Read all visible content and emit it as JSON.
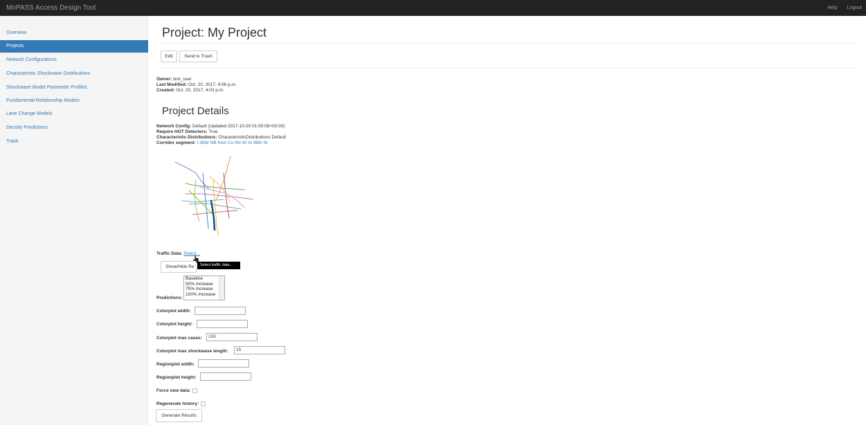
{
  "app": {
    "title": "MnPASS Access Design Tool"
  },
  "nav": {
    "help": "Help",
    "logout": "Logout"
  },
  "sidebar": {
    "items": [
      {
        "label": "Overview"
      },
      {
        "label": "Projects"
      },
      {
        "label": "Network Configurations"
      },
      {
        "label": "Characteristic Shockwave Distributions"
      },
      {
        "label": "Shockwave Model Parameter Profiles"
      },
      {
        "label": "Fundamental Relationship Models"
      },
      {
        "label": "Lane Change Models"
      },
      {
        "label": "Density Predictions"
      },
      {
        "label": "Trash"
      }
    ]
  },
  "project": {
    "title": "Project: My Project",
    "edit": "Edit",
    "trash": "Send to Trash",
    "owner_label": "Owner:",
    "owner": "test_user",
    "modified_label": "Last Modified:",
    "modified": "Oct. 20, 2017, 4:06 p.m.",
    "created_label": "Created:",
    "created": "Oct. 20, 2017, 4:03 p.m."
  },
  "details": {
    "title": "Project Details",
    "network_label": "Network Config:",
    "network": "Default (Updated 2017-10-20 01:00:08+00:00)",
    "hot_label": "Require HOT Detectors:",
    "hot": "True",
    "dist_label": "Characteristic Distributions:",
    "dist": "CharacteristicDistributions Default",
    "corridor_label": "Corridor segment:",
    "corridor": "I-35W NB from Co Rd 42 to 46th St"
  },
  "traffic": {
    "label": "Traffic Data:",
    "link": "Select...",
    "tooltip": "Select traffic data...",
    "showhide": "Show/Hide Re"
  },
  "predictions": {
    "label": "Predictions:",
    "options": [
      "Baseline",
      "50% Increase",
      "75% Increase",
      "100% Increase"
    ]
  },
  "form": {
    "cp_width": "Colorplot width:",
    "cp_height": "Colorplot height:",
    "cp_max_cases": "Colorplot max cases:",
    "cp_max_cases_val": "100",
    "cp_max_sw": "Colorplot max shockwave length:",
    "cp_max_sw_val": "15",
    "rp_width": "Regionplot width:",
    "rp_height": "Regionplot height:",
    "force": "Force new data:",
    "regen": "Regenerate history:",
    "generate": "Generate Results"
  },
  "colors": {
    "brand": "#337ab7",
    "navbar": "#222222"
  }
}
